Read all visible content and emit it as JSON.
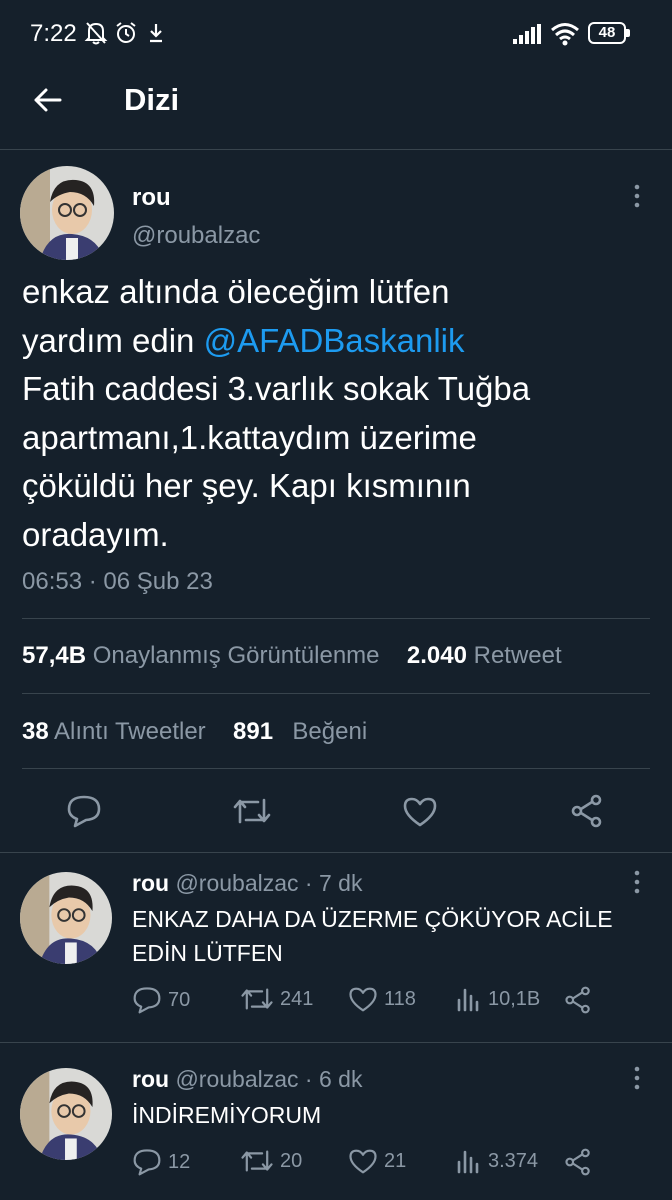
{
  "status_bar": {
    "time": "7:22",
    "battery": "48"
  },
  "header": {
    "title": "Dizi"
  },
  "tweet": {
    "name": "rou",
    "handle": "@roubalzac",
    "text_line1": "enkaz altında öleceğim lütfen",
    "text_line2_prefix": "yardım edin ",
    "mention": "@AFADBaskanlik",
    "text_line3": "Fatih caddesi 3.varlık sokak Tuğba",
    "text_line4": "apartmanı,1.kattaydım üzerime",
    "text_line5": "çöküldü her şey. Kapı kısmının",
    "text_line6": "oradayım.",
    "timestamp": "06:53 · 06 Şub 23",
    "views_count": "57,4B",
    "views_label": "Onaylanmış Görüntülenme",
    "retweets_count": "2.040",
    "retweets_label": "Retweet",
    "quotes_count": "38",
    "quotes_label": "Alıntı Tweetler",
    "likes_count": "891",
    "likes_label": "Beğeni"
  },
  "replies": [
    {
      "name": "rou",
      "handle_time": "@roubalzac · 7 dk",
      "text_line1": "ENKAZ DAHA DA ÜZERME ÇÖKÜYOR ACİLE",
      "text_line2": "EDİN LÜTFEN",
      "replies": "70",
      "retweets": "241",
      "likes": "118",
      "views": "10,1B"
    },
    {
      "name": "rou",
      "handle_time": "@roubalzac · 6 dk",
      "text_line1": "İNDİREMİYORUM",
      "replies": "12",
      "retweets": "20",
      "likes": "21",
      "views": "3.374"
    }
  ],
  "colors": {
    "background": "#15202b",
    "accent": "#1d9bf0",
    "muted": "#8b98a5",
    "divider": "#38444d"
  }
}
